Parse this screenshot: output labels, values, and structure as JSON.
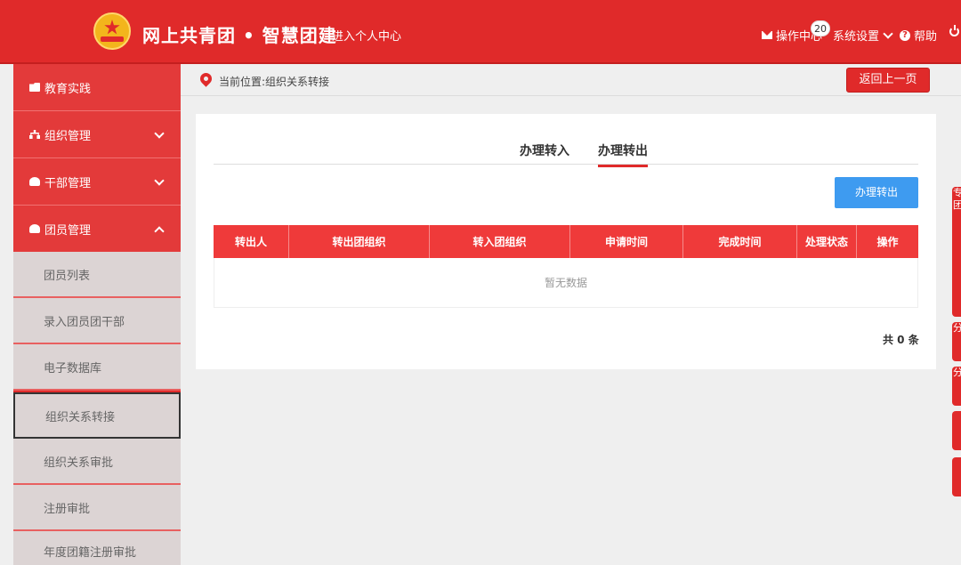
{
  "header": {
    "site_title": "网上共青团 • 智慧团建",
    "personal_center": "进入个人中心",
    "ops_center": "操作中心",
    "ops_badge": "20",
    "system_settings": "系统设置",
    "help": "帮助"
  },
  "sidebar": {
    "top_items": [
      {
        "label": "教育实践"
      },
      {
        "label": "组织管理"
      },
      {
        "label": "干部管理"
      },
      {
        "label": "团员管理"
      }
    ],
    "sub_items": [
      {
        "label": "团员列表"
      },
      {
        "label": "录入团员团干部"
      },
      {
        "label": "电子数据库"
      },
      {
        "label": "组织关系转接"
      },
      {
        "label": "组织关系审批"
      },
      {
        "label": "注册审批"
      },
      {
        "label": "年度团籍注册审批"
      }
    ]
  },
  "breadcrumb": {
    "text": "当前位置:组织关系转接",
    "back_label": "返回上一页"
  },
  "content": {
    "tabs": [
      {
        "label": "办理转入"
      },
      {
        "label": "办理转出"
      }
    ],
    "action_button": "办理转出",
    "columns": [
      "转出人",
      "转出团组织",
      "转入团组织",
      "申请时间",
      "完成时间",
      "处理状态",
      "操作"
    ],
    "empty_text": "暂无数据",
    "total_text": "共 0 条"
  },
  "right_tabs": [
    "专团",
    "分",
    "分"
  ],
  "colors": {
    "primary_red": "#e02a2a",
    "table_head": "#ef3a3a",
    "blue_button": "#3e9bf0",
    "sub_menu_bg": "#dcd4d4"
  }
}
